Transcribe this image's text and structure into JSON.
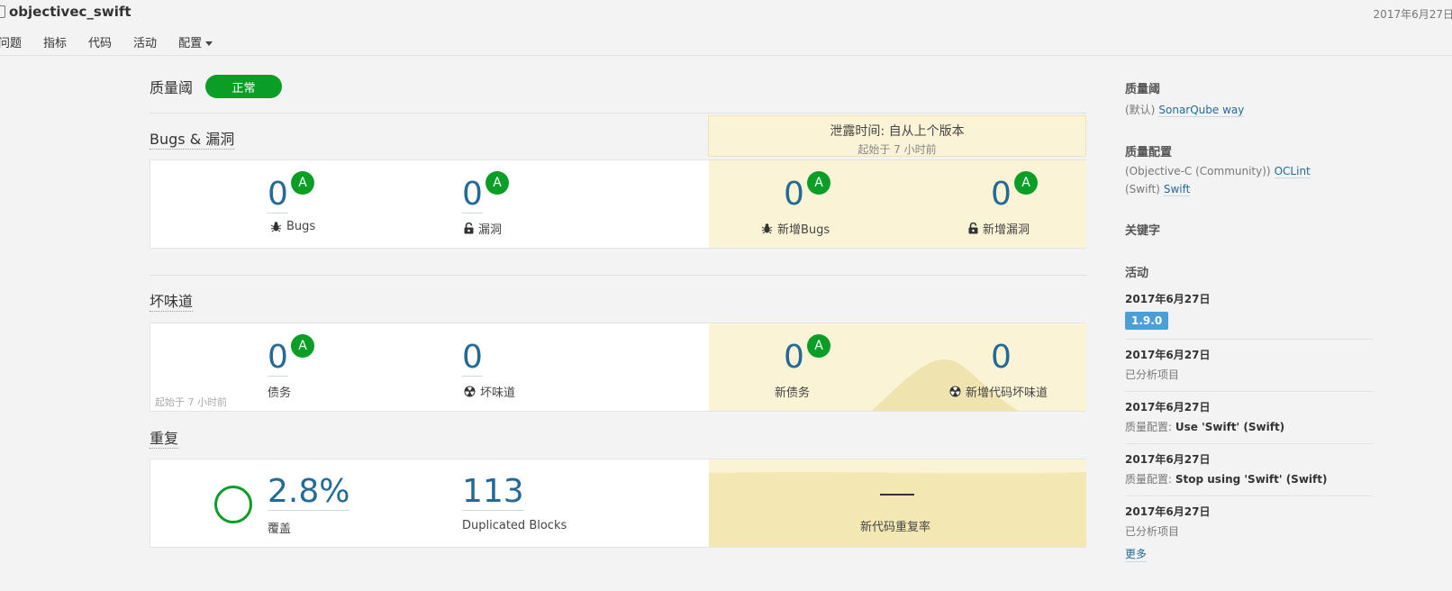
{
  "header": {
    "project_icon": "project-file-icon",
    "project_name": "objectivec_swift",
    "date": "2017年6月27日",
    "nav": [
      "问题",
      "指标",
      "代码",
      "活动",
      "配置"
    ]
  },
  "quality_gate": {
    "label": "质量阈",
    "status": "正常",
    "status_color": "#0a9e27"
  },
  "leak": {
    "title": "泄露时间: 自从上个版本",
    "since": "起始于 7 小时前"
  },
  "bugs_section": {
    "title": "Bugs & 漏洞",
    "bugs": {
      "value": "0",
      "rating": "A",
      "label": "Bugs",
      "icon": "bug-icon"
    },
    "vulns": {
      "value": "0",
      "rating": "A",
      "label": "漏洞",
      "icon": "lock-open-icon"
    },
    "new_bugs": {
      "value": "0",
      "rating": "A",
      "label": "新增Bugs",
      "icon": "bug-icon"
    },
    "new_vulns": {
      "value": "0",
      "rating": "A",
      "label": "新增漏洞",
      "icon": "lock-open-icon"
    }
  },
  "smells_section": {
    "title": "坏味道",
    "debt": {
      "value": "0",
      "rating": "A",
      "label": "债务"
    },
    "smells": {
      "value": "0",
      "label": "坏味道",
      "icon": "radiation-icon"
    },
    "new_debt": {
      "value": "0",
      "rating": "A",
      "label": "新债务"
    },
    "new_smells": {
      "value": "0",
      "label": "新增代码坏味道",
      "icon": "radiation-icon"
    },
    "since": "起始于 7 小时前"
  },
  "dup_section": {
    "title": "重复",
    "coverage": {
      "value": "2.8%",
      "label": "覆盖"
    },
    "blocks": {
      "value": "113",
      "label": "Duplicated Blocks"
    },
    "new_dup": {
      "value": "—",
      "label": "新代码重复率"
    }
  },
  "sidebar": {
    "gate": {
      "heading": "质量阈",
      "prefix": "(默认)",
      "link": "SonarQube way"
    },
    "profiles": {
      "heading": "质量配置",
      "items": [
        {
          "lang": "(Objective-C (Community))",
          "name": "OCLint"
        },
        {
          "lang": "(Swift)",
          "name": "Swift"
        }
      ]
    },
    "tags": {
      "heading": "关键字"
    },
    "activity": {
      "heading": "活动",
      "events": [
        {
          "date": "2017年6月27日",
          "version": "1.9.0"
        },
        {
          "date": "2017年6月27日",
          "text": "已分析项目"
        },
        {
          "date": "2017年6月27日",
          "prefix": "质量配置:",
          "bold": "Use 'Swift' (Swift)"
        },
        {
          "date": "2017年6月27日",
          "prefix": "质量配置:",
          "bold": "Stop using 'Swift' (Swift)"
        },
        {
          "date": "2017年6月27日",
          "text": "已分析项目"
        }
      ],
      "more": "更多"
    }
  }
}
